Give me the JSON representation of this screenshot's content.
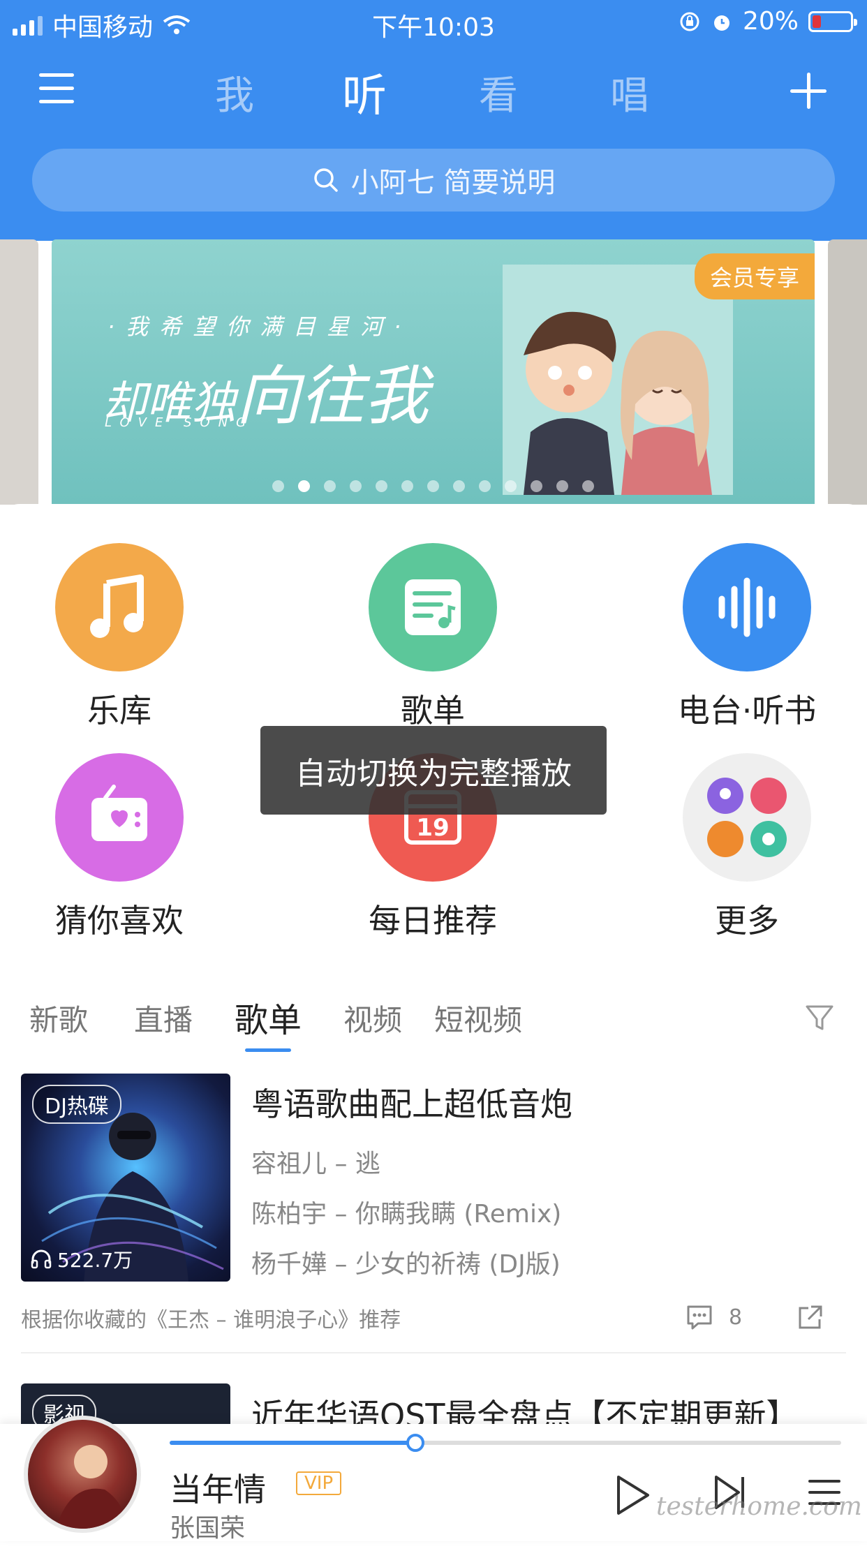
{
  "status_bar": {
    "carrier": "中国移动",
    "time": "下午10:03",
    "battery": "20%"
  },
  "nav": {
    "tabs": [
      "我",
      "听",
      "看",
      "唱"
    ],
    "active_tab": "听"
  },
  "search": {
    "placeholder": "小阿七 简要说明"
  },
  "banner": {
    "subtitle": "·我希望你满目星河·",
    "title_small": "却唯独",
    "title_large": "向往我",
    "tagline": "LOVE SONG",
    "badge": "会员专享",
    "dot_count": 13,
    "active_dot_index": 1
  },
  "categories": [
    {
      "label": "乐库",
      "icon": "music-note-icon",
      "color": "#f3a94a"
    },
    {
      "label": "歌单",
      "icon": "playlist-icon",
      "color": "#5cc79a"
    },
    {
      "label": "电台·听书",
      "icon": "soundwave-icon",
      "color": "#3a8ef0"
    },
    {
      "label": "猜你喜欢",
      "icon": "radio-heart-icon",
      "color": "#d76ce5"
    },
    {
      "label": "每日推荐",
      "icon": "calendar-icon",
      "color": "#ef5a52"
    },
    {
      "label": "更多",
      "icon": "more-grid-icon",
      "color": "#efefef"
    }
  ],
  "calendar_day": "19",
  "toast": "自动切换为完整播放",
  "sub_tabs": [
    "新歌",
    "直播",
    "歌单",
    "视频",
    "短视频"
  ],
  "active_sub_tab": "歌单",
  "playlist": {
    "tag": "DJ热碟",
    "plays": "522.7万",
    "title": "粤语歌曲配上超低音炮",
    "songs": [
      "容祖儿 – 逃",
      "陈柏宇 – 你瞒我瞒 (Remix)",
      "杨千嬅 – 少女的祈祷 (DJ版)"
    ],
    "recommend_reason": "根据你收藏的《王杰 – 谁明浪子心》推荐",
    "comments": "8"
  },
  "playlist2": {
    "tag": "影视",
    "title": "近年华语OST最全盘点【不定期更新】"
  },
  "player": {
    "song": "当年情",
    "vip": "VIP",
    "artist": "张国荣",
    "progress": 0.366
  },
  "watermark": "testerhome.com",
  "colors": {
    "header_blue": "#3b8df0",
    "vip_orange": "#f3a93b"
  }
}
